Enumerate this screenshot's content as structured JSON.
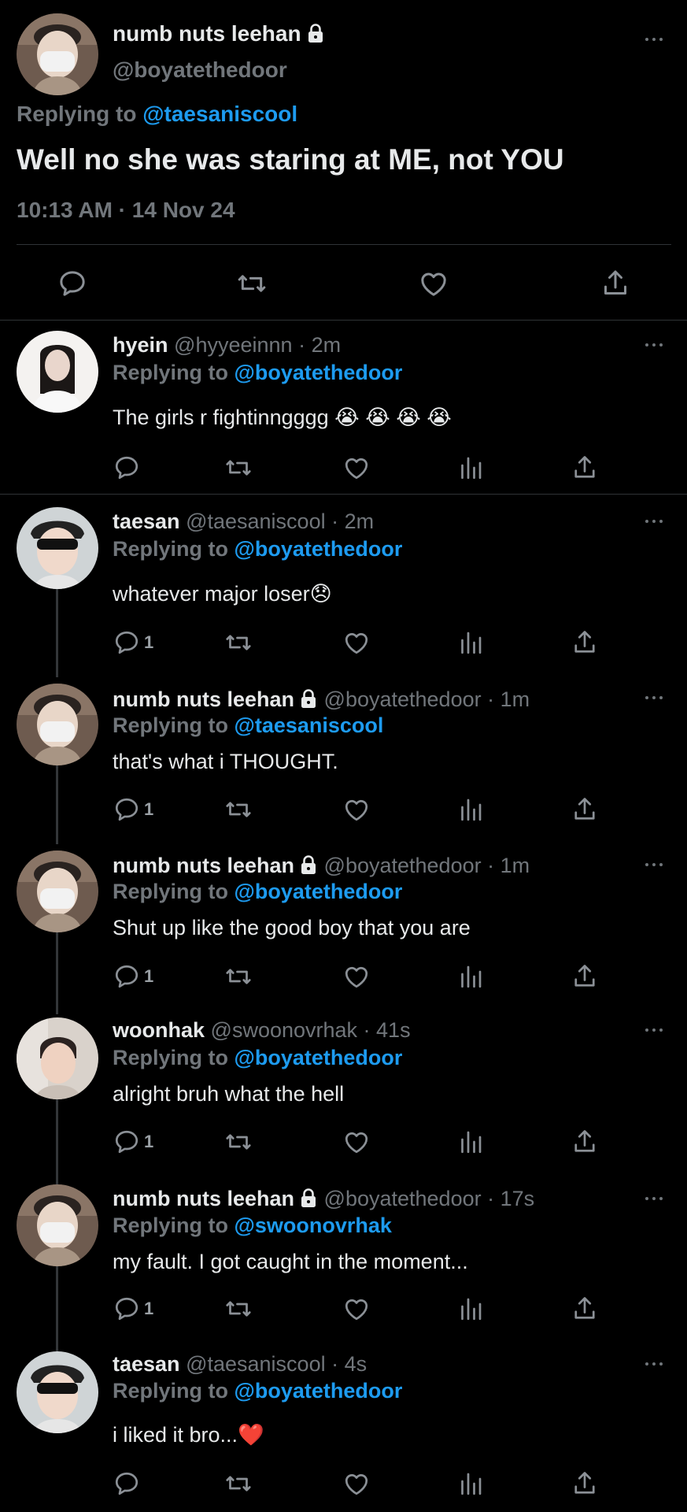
{
  "main_tweet": {
    "display_name": "numb nuts leehan",
    "handle": "@boyatethedoor",
    "replying_label": "Replying to",
    "replying_to": "@taesaniscool",
    "text": "Well no she was staring at ME, not YOU",
    "timestamp": "10:13 AM · 14 Nov 24"
  },
  "replies": [
    {
      "display_name": "hyein",
      "handle": "@hyyeeinnn",
      "time": "· 2m",
      "replying_label": "Replying to",
      "replying_to": "@boyatethedoor",
      "text": "The girls r fightinngggg 😭 😭 😭 😭",
      "reply_count": ""
    },
    {
      "display_name": "taesan",
      "handle": "@taesaniscool",
      "time": "· 2m",
      "replying_label": "Replying to",
      "replying_to": "@boyatethedoor",
      "text": "whatever major loser😞",
      "reply_count": "1"
    },
    {
      "display_name": "numb nuts leehan",
      "handle": "@boyatethedoor",
      "time": "· 1m",
      "replying_label": "Replying to",
      "replying_to": "@taesaniscool",
      "text": "that's what i THOUGHT.",
      "reply_count": "1"
    },
    {
      "display_name": "numb nuts leehan",
      "handle": "@boyatethedoor",
      "time": "· 1m",
      "replying_label": "Replying to",
      "replying_to": "@boyatethedoor",
      "text": "Shut up like the good boy that you are",
      "reply_count": "1"
    },
    {
      "display_name": "woonhak",
      "handle": "@swoonovrhak",
      "time": "· 41s",
      "replying_label": "Replying to",
      "replying_to": "@boyatethedoor",
      "text": "alright bruh what the hell",
      "reply_count": "1"
    },
    {
      "display_name": "numb nuts leehan",
      "handle": "@boyatethedoor",
      "time": "· 17s",
      "replying_label": "Replying to",
      "replying_to": "@swoonovrhak",
      "text": "my fault. I got caught in the moment...",
      "reply_count": "1"
    },
    {
      "display_name": "taesan",
      "handle": "@taesaniscool",
      "time": "· 4s",
      "replying_label": "Replying to",
      "replying_to": "@boyatethedoor",
      "text": "i liked it bro...❤️",
      "reply_count": ""
    }
  ],
  "colors": {
    "background": "#000000",
    "text": "#e7e9ea",
    "muted": "#71767b",
    "accent": "#1d9bf0"
  },
  "icons": [
    "reply-icon",
    "retweet-icon",
    "like-icon",
    "views-icon",
    "share-icon",
    "more-icon",
    "lock-icon"
  ]
}
